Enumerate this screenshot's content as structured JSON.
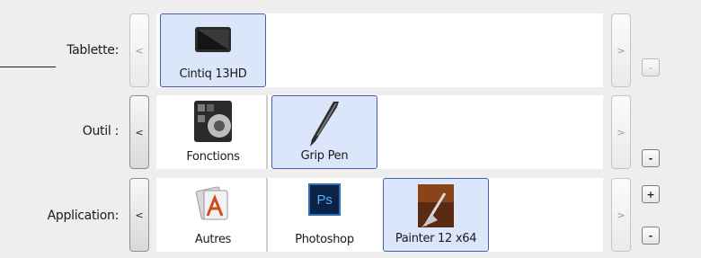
{
  "rows": {
    "tablet": {
      "label": "Tablette:",
      "items": [
        {
          "name": "Cintiq 13HD",
          "selected": true,
          "icon": "tablet-icon"
        }
      ]
    },
    "tool": {
      "label": "Outil :",
      "items": [
        {
          "name": "Fonctions",
          "selected": false,
          "icon": "functions-icon"
        },
        {
          "name": "Grip Pen",
          "selected": true,
          "icon": "pen-icon"
        }
      ]
    },
    "application": {
      "label": "Application:",
      "items": [
        {
          "name": "Autres",
          "selected": false,
          "icon": "other-apps-icon"
        },
        {
          "name": "Photoshop",
          "selected": false,
          "icon": "photoshop-icon"
        },
        {
          "name": "Painter 12 x64",
          "selected": true,
          "icon": "painter-icon"
        }
      ]
    }
  },
  "buttons": {
    "prev": "<",
    "next": ">",
    "add": "+",
    "remove": "-",
    "ps_text": "Ps"
  }
}
